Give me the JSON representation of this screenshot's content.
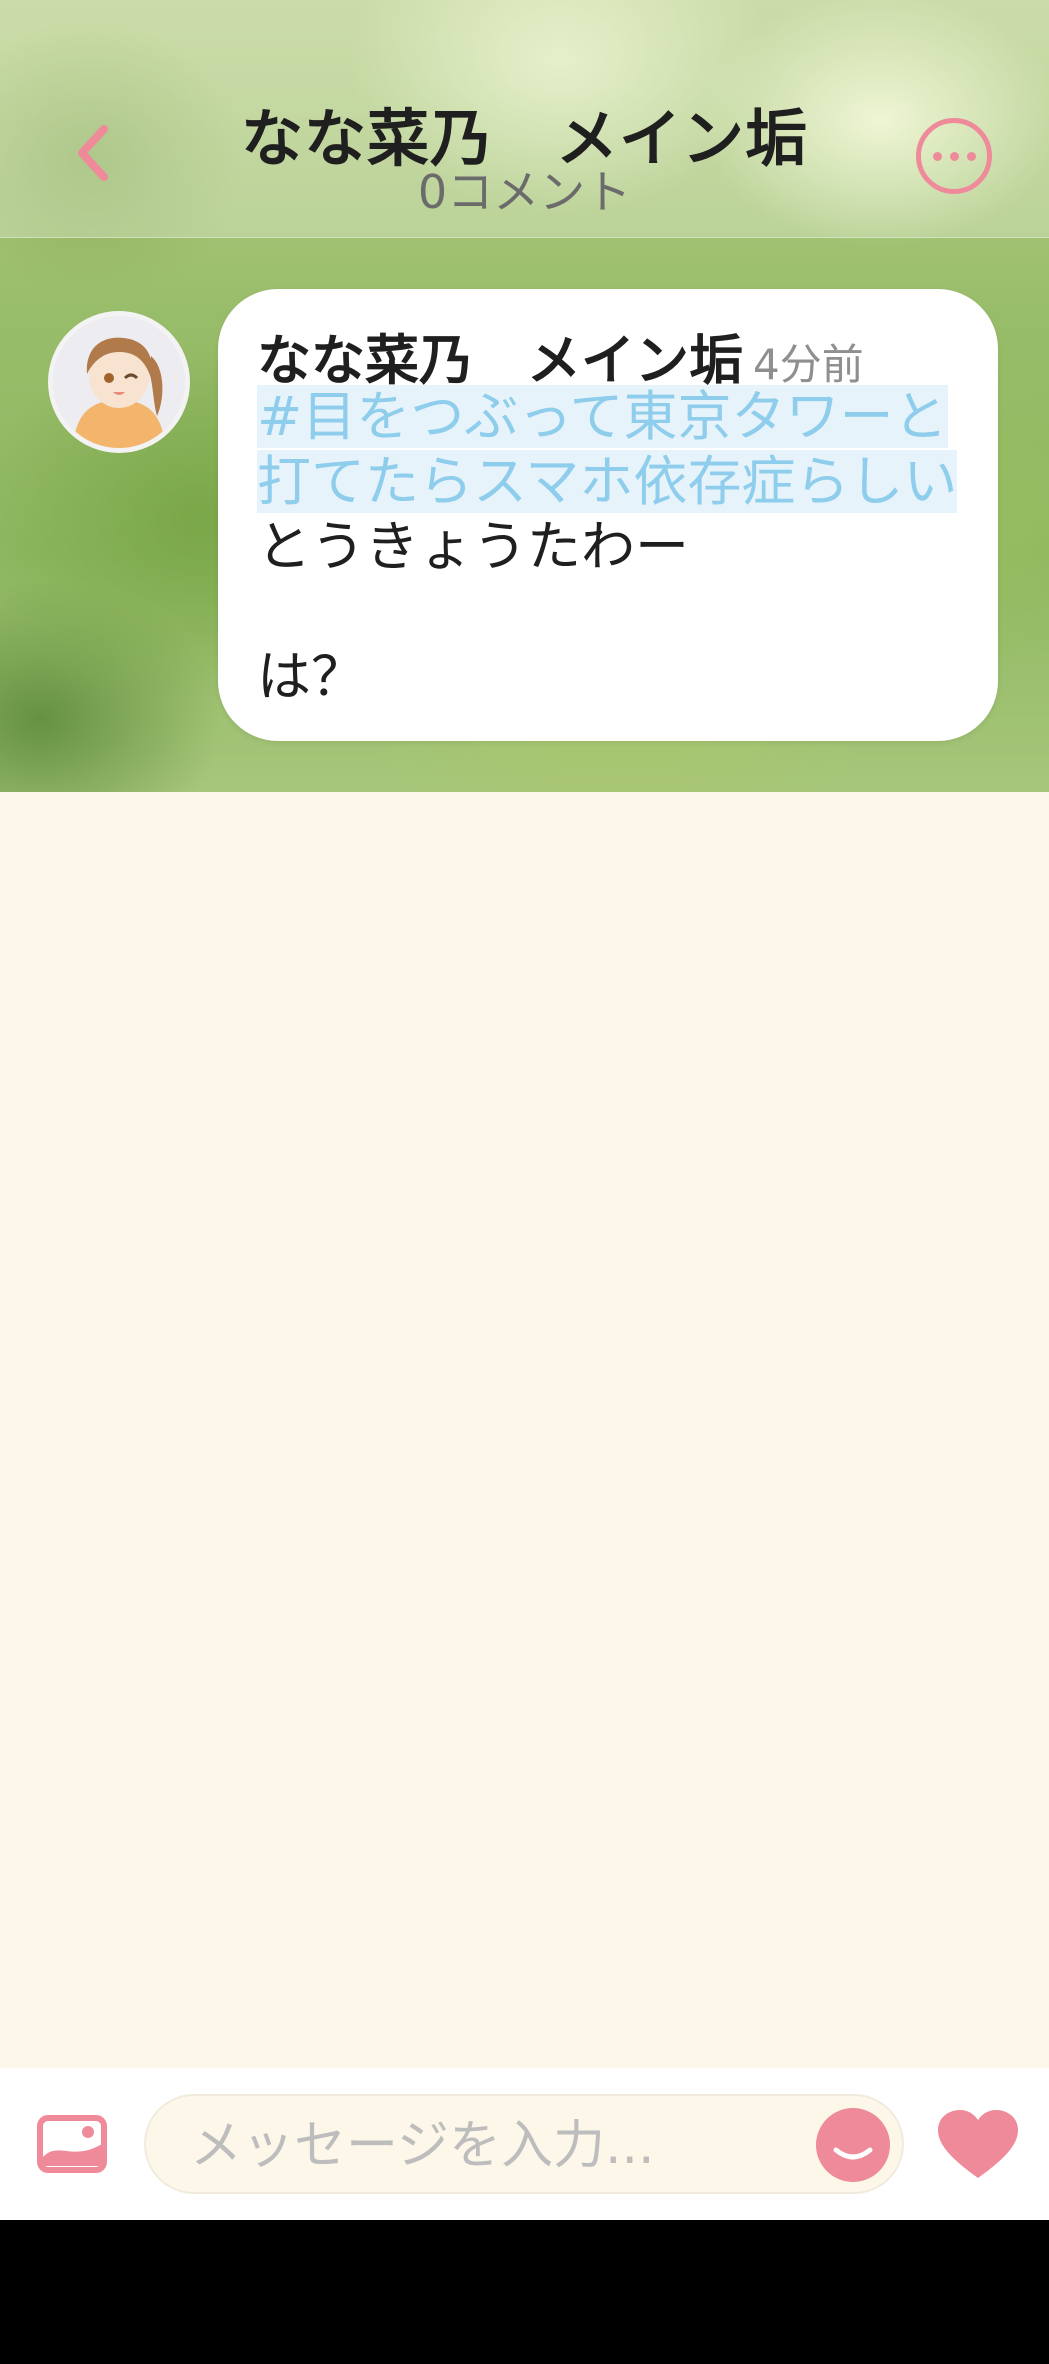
{
  "header": {
    "title": "なな菜乃　メイン垢",
    "subtitle": "0コメント",
    "back_icon": "chevron-left-icon",
    "more_icon": "more-horizontal-icon"
  },
  "post": {
    "author": "なな菜乃　メイン垢",
    "time": "4分前",
    "hashtag_lines": [
      "#目をつぶって東京タワーと",
      "打てたらスマホ依存症らしい"
    ],
    "text_lines": [
      "とうきょうたわー",
      "",
      "は？"
    ]
  },
  "composer": {
    "placeholder": "メッセージを入力...",
    "image_icon": "image-icon",
    "emoji_icon": "smile-icon",
    "like_icon": "heart-icon"
  },
  "colors": {
    "accent": "#ef8a9a",
    "hashtag": "#8fcdec",
    "background": "#fdf7ea"
  }
}
